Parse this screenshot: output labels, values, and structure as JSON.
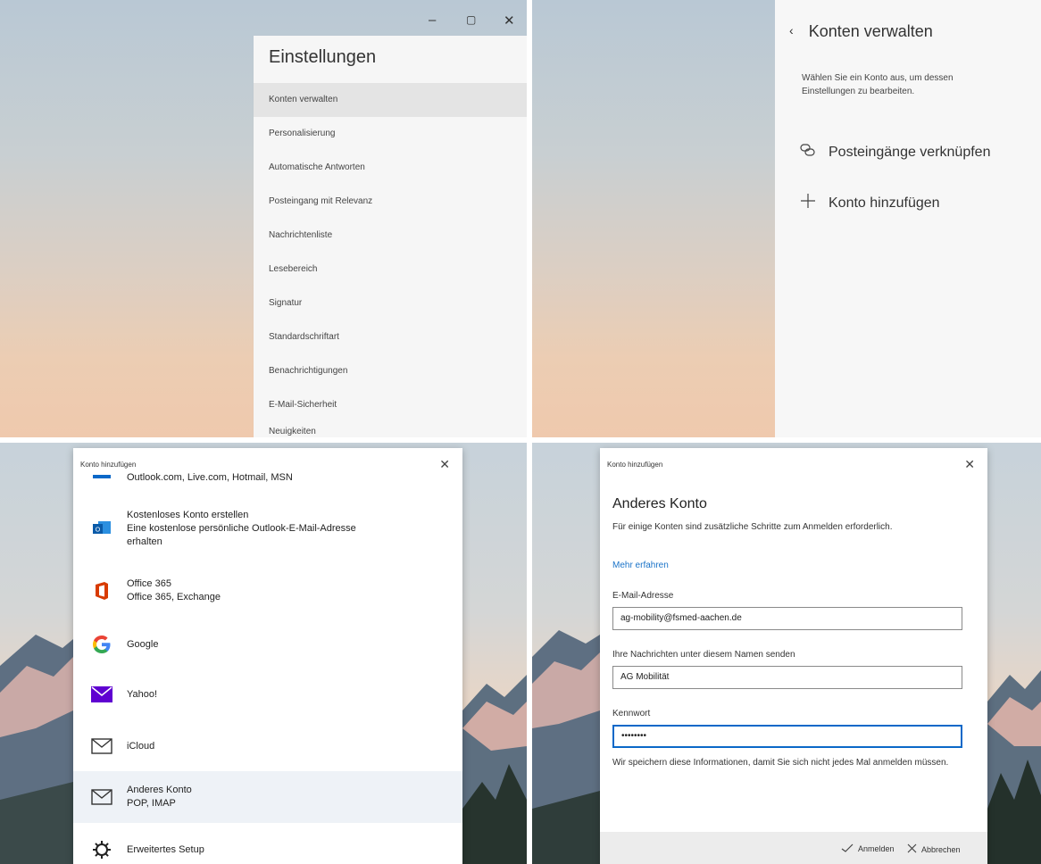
{
  "q1": {
    "window_controls": [
      "–",
      "▢",
      "✕"
    ],
    "title": "Einstellungen",
    "items": [
      "Konten verwalten",
      "Personalisierung",
      "Automatische Antworten",
      "Posteingang mit Relevanz",
      "Nachrichtenliste",
      "Lesebereich",
      "Signatur",
      "Standardschriftart",
      "Benachrichtigungen",
      "E-Mail-Sicherheit",
      "Neuigkeiten"
    ],
    "selected_index": 0
  },
  "q2": {
    "back_icon": "back-chevron-icon",
    "title": "Konten verwalten",
    "description": "Wählen Sie ein Konto aus, um dessen Einstellungen zu bearbeiten.",
    "actions": [
      {
        "icon": "link-icon",
        "label": "Posteingänge verknüpfen"
      },
      {
        "icon": "plus-icon",
        "label": "Konto hinzufügen"
      }
    ]
  },
  "q3": {
    "dialog_title": "Konto hinzufügen",
    "providers": [
      {
        "icon": "outlook-bar-icon",
        "line1": "Outlook.com, Live.com, Hotmail, MSN",
        "line2": "",
        "line3": ""
      },
      {
        "icon": "outlook-new-icon",
        "line1": "Kostenloses Konto erstellen",
        "line2": "Eine kostenlose persönliche Outlook-E-Mail-Adresse",
        "line3": "erhalten"
      },
      {
        "icon": "office365-icon",
        "line1": "Office 365",
        "line2": "Office 365, Exchange",
        "line3": ""
      },
      {
        "icon": "google-icon",
        "line1": "Google",
        "line2": "",
        "line3": ""
      },
      {
        "icon": "yahoo-icon",
        "line1": "Yahoo!",
        "line2": "",
        "line3": ""
      },
      {
        "icon": "mail-envelope-icon",
        "line1": "iCloud",
        "line2": "",
        "line3": ""
      },
      {
        "icon": "mail-envelope-icon",
        "line1": "Anderes Konto",
        "line2": "POP, IMAP",
        "line3": ""
      },
      {
        "icon": "gear-icon",
        "line1": "Erweitertes Setup",
        "line2": "",
        "line3": ""
      }
    ],
    "selected_index": 6
  },
  "q4": {
    "dialog_title": "Konto hinzufügen",
    "heading": "Anderes Konto",
    "intro": "Für einige Konten sind zusätzliche Schritte zum Anmelden erforderlich.",
    "link": "Mehr erfahren",
    "email_label": "E-Mail-Adresse",
    "email_value": "ag-mobility@fsmed-aachen.de",
    "name_label": "Ihre Nachrichten unter diesem Namen senden",
    "name_value": "AG Mobilität",
    "password_label": "Kennwort",
    "password_value": "••••••••",
    "note": "Wir speichern diese Informationen, damit Sie sich nicht jedes Mal anmelden müssen.",
    "sign_in": "Anmelden",
    "cancel": "Abbrechen"
  },
  "colors": {
    "accent": "#0a68c8",
    "link": "#1a73c8",
    "yahoo": "#5f01d1",
    "office": "#d83b01"
  }
}
